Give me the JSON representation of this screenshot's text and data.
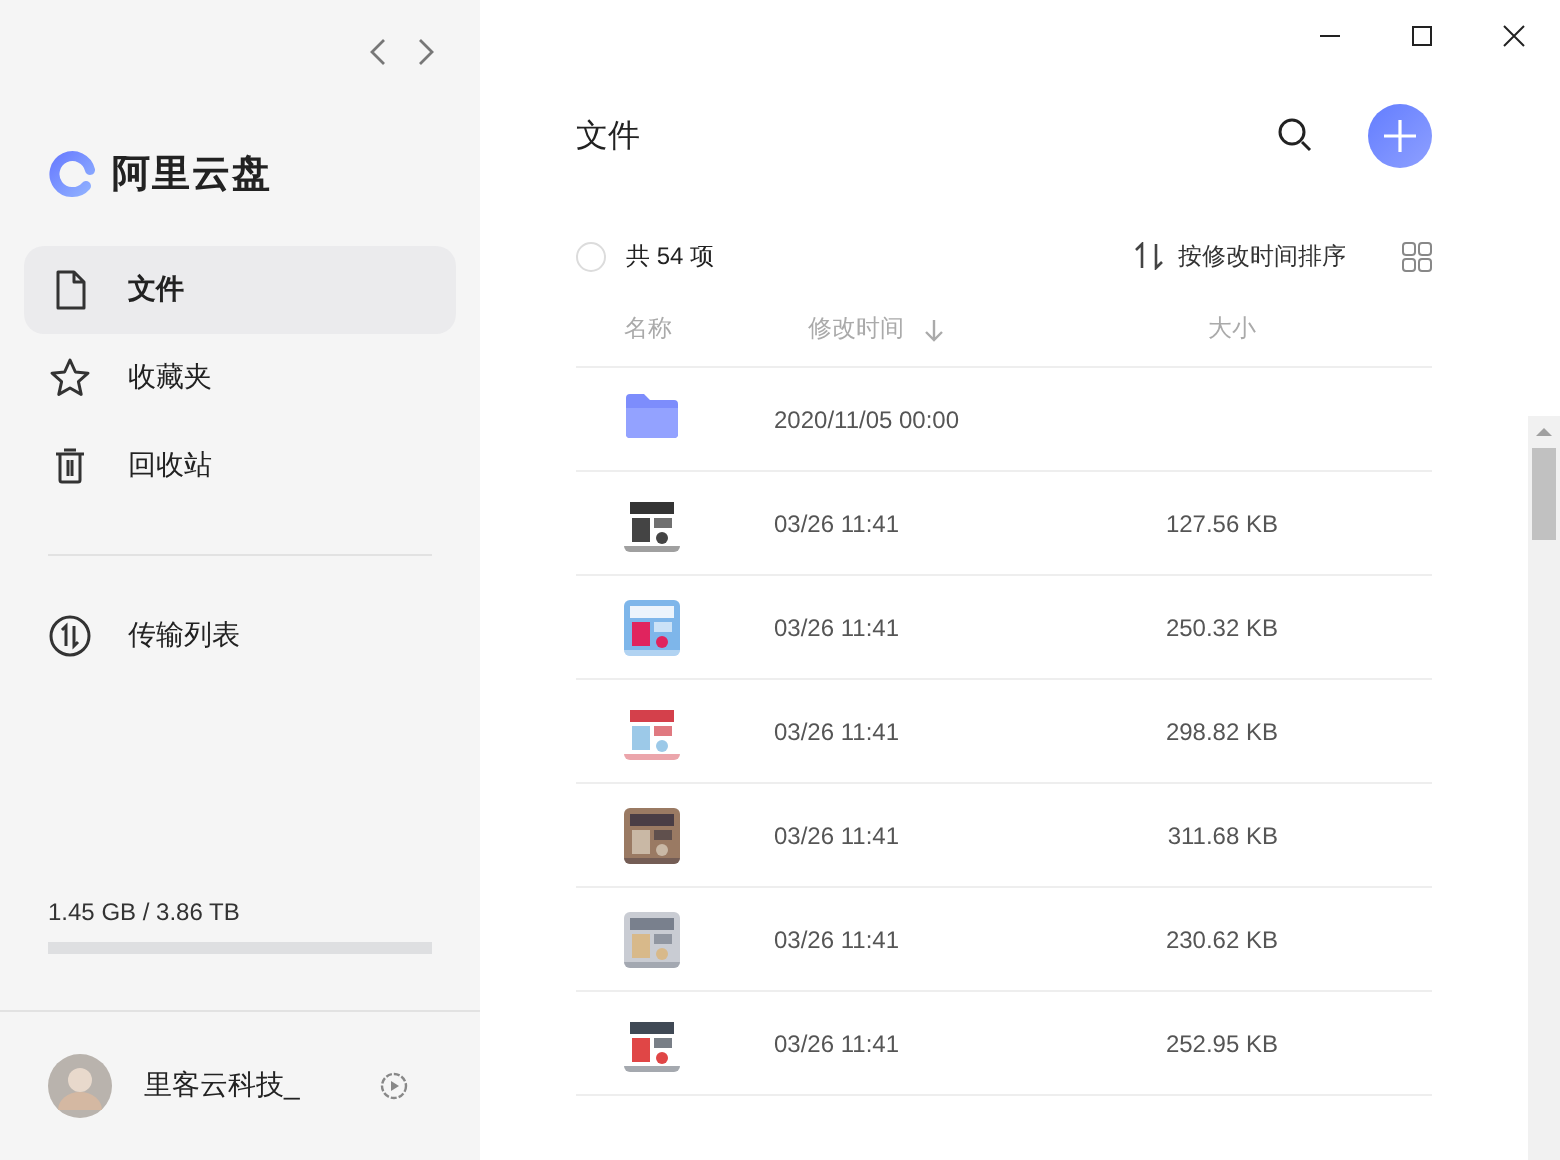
{
  "app": {
    "name": "阿里云盘"
  },
  "sidebar": {
    "items": [
      {
        "label": "文件",
        "kind": "file",
        "selected": true
      },
      {
        "label": "收藏夹",
        "kind": "star",
        "selected": false
      },
      {
        "label": "回收站",
        "kind": "trash",
        "selected": false
      }
    ],
    "transfer": {
      "label": "传输列表"
    },
    "storage": {
      "reading": "1.45 GB / 3.86 TB",
      "level": 0.0004
    },
    "user": {
      "name": "里客云科技_"
    }
  },
  "main": {
    "title": "文件",
    "select_all": {
      "checked": false
    },
    "count": "共 54 项",
    "sort": "按修改时间排序",
    "columns": [
      "名称",
      "修改时间",
      "大小"
    ],
    "rows": [
      {
        "kind": "folder",
        "modified": "2020/11/05 00:00"
      },
      {
        "kind": "picture",
        "modified": "03/26 11:41",
        "size": "127.56 KB"
      },
      {
        "kind": "picture",
        "modified": "03/26 11:41",
        "size": "250.32 KB"
      },
      {
        "kind": "picture",
        "modified": "03/26 11:41",
        "size": "298.82 KB"
      },
      {
        "kind": "picture",
        "modified": "03/26 11:41",
        "size": "311.68 KB"
      },
      {
        "kind": "picture",
        "modified": "03/26 11:41",
        "size": "230.62 KB"
      },
      {
        "kind": "picture",
        "modified": "03/26 11:41",
        "size": "252.95 KB"
      }
    ]
  }
}
